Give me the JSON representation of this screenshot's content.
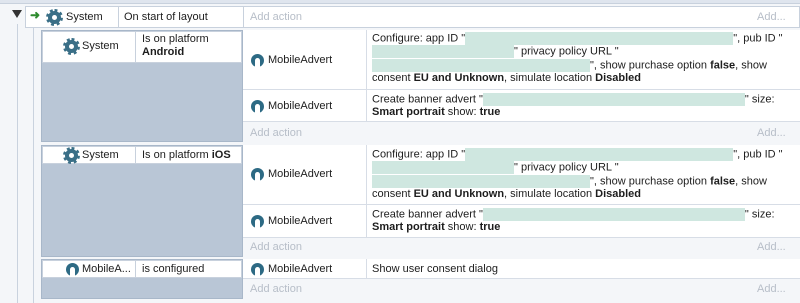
{
  "root_event": {
    "object": "System",
    "condition": "On start of layout",
    "add_action": "Add action",
    "add_right": "Add..."
  },
  "subevents": [
    {
      "cond_object": "System",
      "cond_text": "Is on platform",
      "cond_bold": "Android",
      "actions": [
        {
          "object": "MobileAdvert",
          "parts": [
            "Configure: app ID \"",
            "\", pub ID \"",
            "\" privacy policy URL \"",
            "\", show purchase option ",
            "false",
            ", show consent ",
            "EU and Unknown",
            ", simulate location ",
            "Disabled"
          ]
        },
        {
          "object": "MobileAdvert",
          "parts": [
            "Create banner advert \"",
            "\" size: ",
            "Smart portrait",
            " show: ",
            "true"
          ]
        }
      ],
      "add_action": "Add action",
      "add_right": "Add..."
    },
    {
      "cond_object": "System",
      "cond_text": "Is on platform",
      "cond_bold": "iOS",
      "actions": [
        {
          "object": "MobileAdvert",
          "parts": [
            "Configure: app ID \"",
            "\", pub ID \"",
            "\" privacy policy URL \"",
            "\", show purchase option ",
            "false",
            ", show consent ",
            "EU and Unknown",
            ", simulate location ",
            "Disabled"
          ]
        },
        {
          "object": "MobileAdvert",
          "parts": [
            "Create banner advert \"",
            "\" size: ",
            "Smart portrait",
            " show: ",
            "true"
          ]
        }
      ],
      "add_action": "Add action",
      "add_right": "Add..."
    },
    {
      "cond_object": "MobileA...",
      "cond_text": "is configured",
      "cond_bold": "",
      "actions": [
        {
          "object": "MobileAdvert",
          "parts": [
            "Show user consent dialog"
          ]
        }
      ],
      "add_action": "Add action",
      "add_right": "Add..."
    }
  ],
  "colors": {
    "accent": "#3a6f87",
    "arrow": "#2e8b2e",
    "redaction": "#cfe7e0",
    "block": "#b9c6d6"
  },
  "icons": {
    "system": "gear-icon",
    "mobile_advert": "mobile-advert-icon",
    "trigger": "arrow-right-icon",
    "toggle": "triangle-down-icon"
  }
}
